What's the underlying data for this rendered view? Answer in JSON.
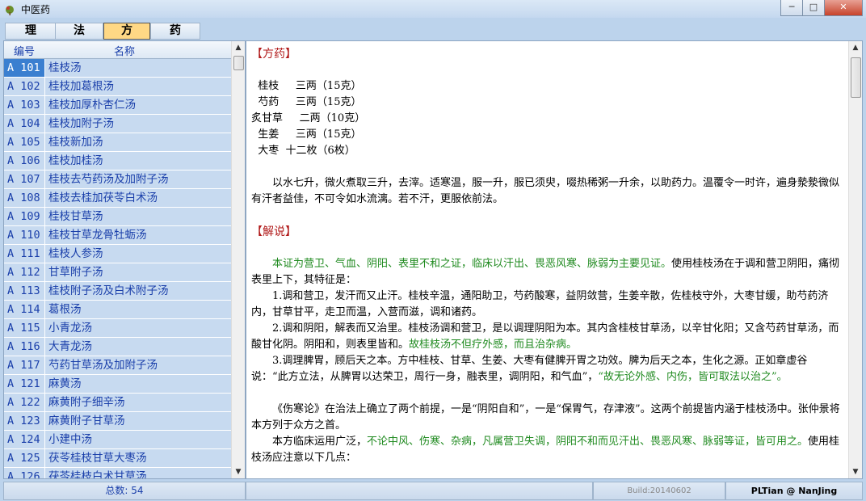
{
  "window": {
    "title": "中医药",
    "min": "─",
    "max": "□",
    "close": "✕"
  },
  "tabs": [
    {
      "label": "理"
    },
    {
      "label": "法"
    },
    {
      "label": "方"
    },
    {
      "label": "药"
    }
  ],
  "list": {
    "col_code": "编号",
    "col_name": "名称",
    "rows": [
      {
        "code": "A 101",
        "name": "桂枝汤"
      },
      {
        "code": "A 102",
        "name": "桂枝加葛根汤"
      },
      {
        "code": "A 103",
        "name": "桂枝加厚朴杏仁汤"
      },
      {
        "code": "A 104",
        "name": "桂枝加附子汤"
      },
      {
        "code": "A 105",
        "name": "桂枝新加汤"
      },
      {
        "code": "A 106",
        "name": "桂枝加桂汤"
      },
      {
        "code": "A 107",
        "name": "桂枝去芍药汤及加附子汤"
      },
      {
        "code": "A 108",
        "name": "桂枝去桂加茯苓白术汤"
      },
      {
        "code": "A 109",
        "name": "桂枝甘草汤"
      },
      {
        "code": "A 110",
        "name": "桂枝甘草龙骨牡蛎汤"
      },
      {
        "code": "A 111",
        "name": "桂枝人参汤"
      },
      {
        "code": "A 112",
        "name": "甘草附子汤"
      },
      {
        "code": "A 113",
        "name": "桂枝附子汤及白术附子汤"
      },
      {
        "code": "A 114",
        "name": "葛根汤"
      },
      {
        "code": "A 115",
        "name": "小青龙汤"
      },
      {
        "code": "A 116",
        "name": "大青龙汤"
      },
      {
        "code": "A 117",
        "name": "芍药甘草汤及加附子汤"
      },
      {
        "code": "A 121",
        "name": "麻黄汤"
      },
      {
        "code": "A 122",
        "name": "麻黄附子细辛汤"
      },
      {
        "code": "A 123",
        "name": "麻黄附子甘草汤"
      },
      {
        "code": "A 124",
        "name": "小建中汤"
      },
      {
        "code": "A 125",
        "name": "茯苓桂枝甘草大枣汤"
      },
      {
        "code": "A 126",
        "name": "茯苓桂枝白术甘草汤"
      }
    ]
  },
  "content": {
    "section1": "【方药】",
    "herbs": [
      "  桂枝     三两（15克）",
      "  芍药     三两（15克）",
      "炙甘草     二两（10克）",
      "  生姜     三两（15克）",
      "  大枣  十二枚（6枚）"
    ],
    "method": "以水七升，微火煮取三升，去滓。适寒温，服一升，服已须臾，啜热稀粥一升余，以助药力。温覆令一时许，遍身漐漐微似有汗者益佳，不可令如水流漓。若不汗，更服依前法。",
    "section2": "【解说】",
    "p1_green": "本证为营卫、气血、阴阳、表里不和之证，临床以汗出、畏恶风寒、脉弱为主要见证。",
    "p1_rest": "使用桂枝汤在于调和营卫阴阳，痛彻表里上下，其特征是：",
    "p2": "1.调和营卫，发汗而又止汗。桂枝辛温，通阳助卫，芍药酸寒，益阴敛营，生姜辛散，佐桂枝守外，大枣甘缓，助芍药济内，甘草甘平，走卫而温，入营而滋，调和诸药。",
    "p3_a": "2.调和阴阳，解表而又治里。桂枝汤调和营卫，是以调理阴阳为本。其内含桂枝甘草汤，以辛甘化阳；又含芍药甘草汤，而酸甘化阴。阴阳和，则表里皆和。",
    "p3_green": "故桂枝汤不但疗外感，而且治杂病。",
    "p4_a": "3.调理脾胃，顾后天之本。方中桂枝、甘草、生姜、大枣有健脾开胃之功效。脾为后天之本，生化之源。正如章虚谷说：“此方立法，从脾胃以达荣卫，周行一身，融表里，调阴阳，和气血”，",
    "p4_green": "“故无论外感、内伤，皆可取法以治之”。",
    "p5": "《伤寒论》在治法上确立了两个前提，一是“阴阳自和”，一是“保胃气，存津液”。这两个前提皆内涵于桂枝汤中。张仲景将本方列于众方之首。",
    "p6_a": "本方临床运用广泛，",
    "p6_green": "不论中风、伤寒、杂病，凡属营卫失调，阴阳不和而见汗出、畏恶风寒、脉弱等证，皆可用之。",
    "p6_b": "使用桂枝汤应注意以下几点："
  },
  "status": {
    "total": "总数: 54",
    "build": "Build:20140602",
    "author": "PLTian @ NanJing"
  }
}
